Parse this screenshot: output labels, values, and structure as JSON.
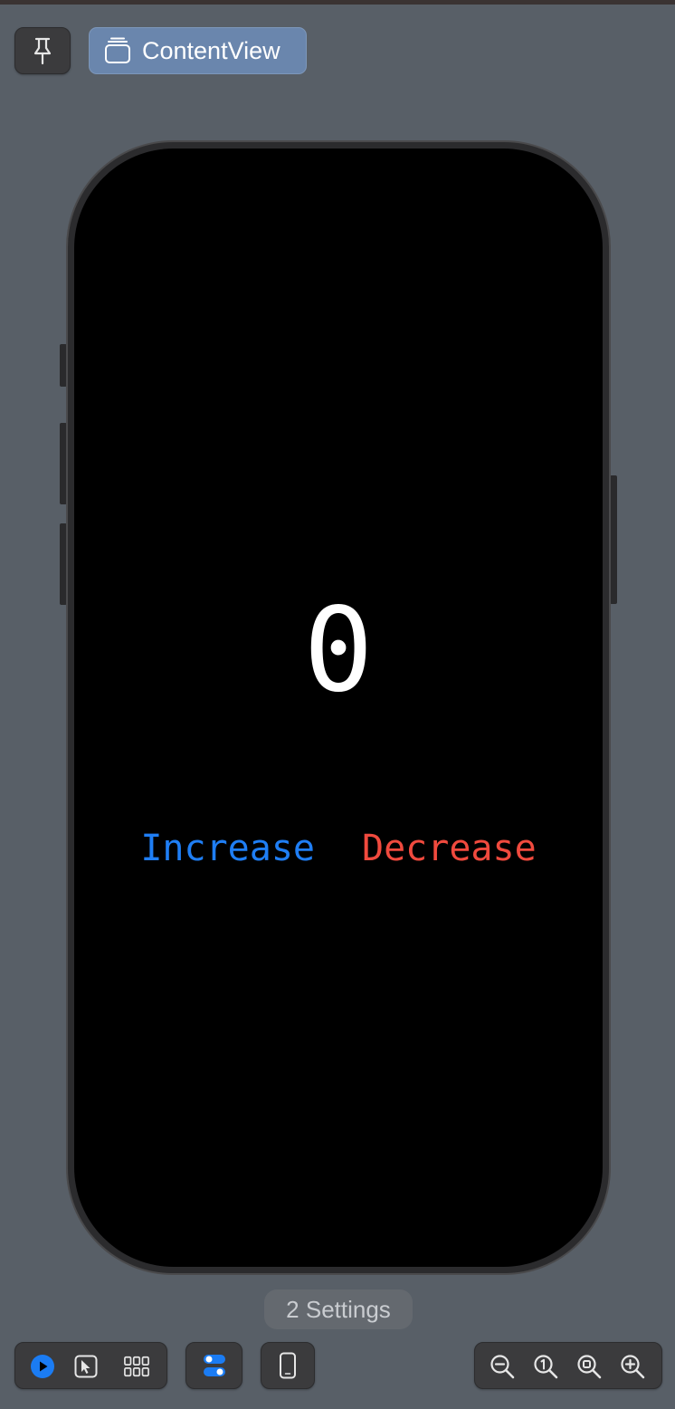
{
  "toolbar": {
    "pin_icon": "pin-icon",
    "view_icon": "stack-icon",
    "view_name": "ContentView"
  },
  "preview": {
    "counter_value": "0",
    "increase_label": "Increase",
    "decrease_label": "Decrease",
    "colors": {
      "increase": "#1f7ef4",
      "decrease": "#f04a3e",
      "counter": "#ffffff",
      "screen": "#000000"
    }
  },
  "canvas": {
    "settings_label": "2 Settings"
  },
  "bottom_bar": {
    "mode_icons": [
      "play-icon",
      "selectable-icon",
      "grid-icon"
    ],
    "variants_icon": "variants-toggle-icon",
    "device_icon": "device-icon",
    "zoom_icons": [
      "zoom-out-icon",
      "zoom-actual-size-icon",
      "zoom-to-fit-icon",
      "zoom-in-icon"
    ],
    "accent": "#1b7cf3"
  }
}
